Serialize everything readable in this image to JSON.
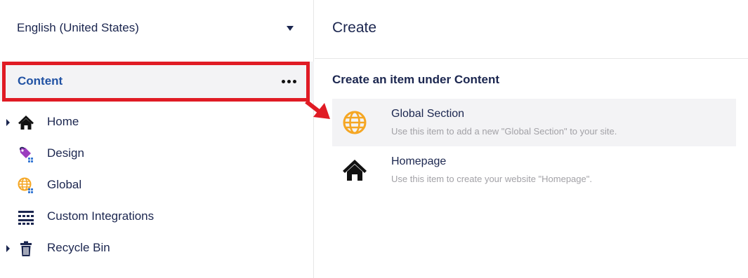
{
  "sidebar": {
    "culture": {
      "label": "English (United States)"
    },
    "root": {
      "label": "Content"
    },
    "items": [
      {
        "label": "Home",
        "icon": "house-icon",
        "expandable": true
      },
      {
        "label": "Design",
        "icon": "paint-tag-icon",
        "expandable": false
      },
      {
        "label": "Global",
        "icon": "globe-icon",
        "expandable": false
      },
      {
        "label": "Custom Integrations",
        "icon": "grid-icon",
        "expandable": false
      },
      {
        "label": "Recycle Bin",
        "icon": "trash-icon",
        "expandable": true
      }
    ]
  },
  "panel": {
    "title": "Create",
    "section_title": "Create an item under Content",
    "items": [
      {
        "name": "Global Section",
        "description": "Use this item to add a new \"Global Section\" to your site.",
        "icon": "globe-icon",
        "selected": true
      },
      {
        "name": "Homepage",
        "description": "Use this item to create your website \"Homepage\".",
        "icon": "house-icon",
        "selected": false
      }
    ]
  },
  "colors": {
    "text": "#1b264f",
    "accent_blue": "#2152a3",
    "highlight_red": "#e01b24",
    "globe_orange": "#f5a623",
    "design_purple": "#9b3dbf",
    "muted": "#a2a1a6",
    "selected_bg": "#f3f3f5"
  }
}
